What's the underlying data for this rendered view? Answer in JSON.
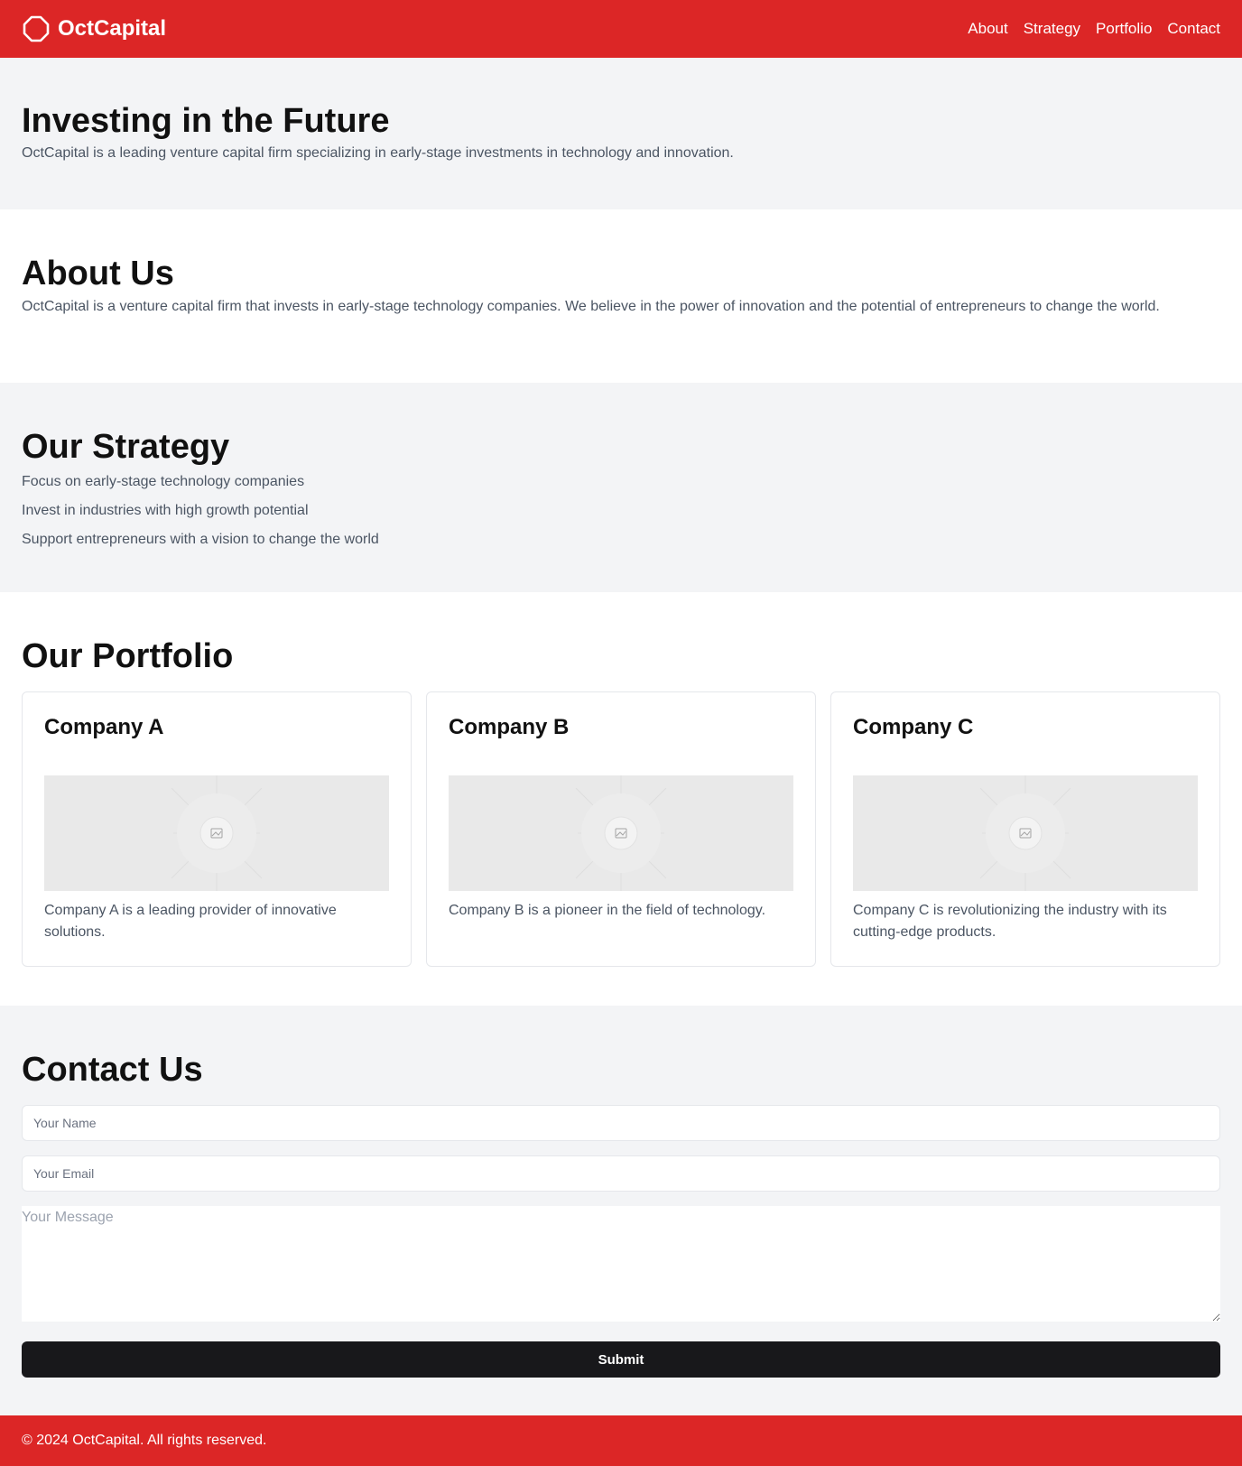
{
  "header": {
    "brand": "OctCapital",
    "logo_icon": "octagon-icon",
    "nav": [
      {
        "label": "About"
      },
      {
        "label": "Strategy"
      },
      {
        "label": "Portfolio"
      },
      {
        "label": "Contact"
      }
    ]
  },
  "hero": {
    "title": "Investing in the Future",
    "subtitle": "OctCapital is a leading venture capital firm specializing in early-stage investments in technology and innovation."
  },
  "about": {
    "title": "About Us",
    "text": "OctCapital is a venture capital firm that invests in early-stage technology companies. We believe in the power of innovation and the potential of entrepreneurs to change the world."
  },
  "strategy": {
    "title": "Our Strategy",
    "items": [
      "Focus on early-stage technology companies",
      "Invest in industries with high growth potential",
      "Support entrepreneurs with a vision to change the world"
    ]
  },
  "portfolio": {
    "title": "Our Portfolio",
    "companies": [
      {
        "name": "Company A",
        "description": "Company A is a leading provider of innovative solutions."
      },
      {
        "name": "Company B",
        "description": "Company B is a pioneer in the field of technology."
      },
      {
        "name": "Company C",
        "description": "Company C is revolutionizing the industry with its cutting-edge products."
      }
    ]
  },
  "contact": {
    "title": "Contact Us",
    "name_placeholder": "Your Name",
    "email_placeholder": "Your Email",
    "message_placeholder": "Your Message",
    "submit_label": "Submit"
  },
  "footer": {
    "text": "© 2024 OctCapital. All rights reserved."
  },
  "colors": {
    "brand_red": "#dc2626",
    "section_gray": "#f3f4f6",
    "button_dark": "#18181b",
    "body_text": "#4b5563"
  }
}
